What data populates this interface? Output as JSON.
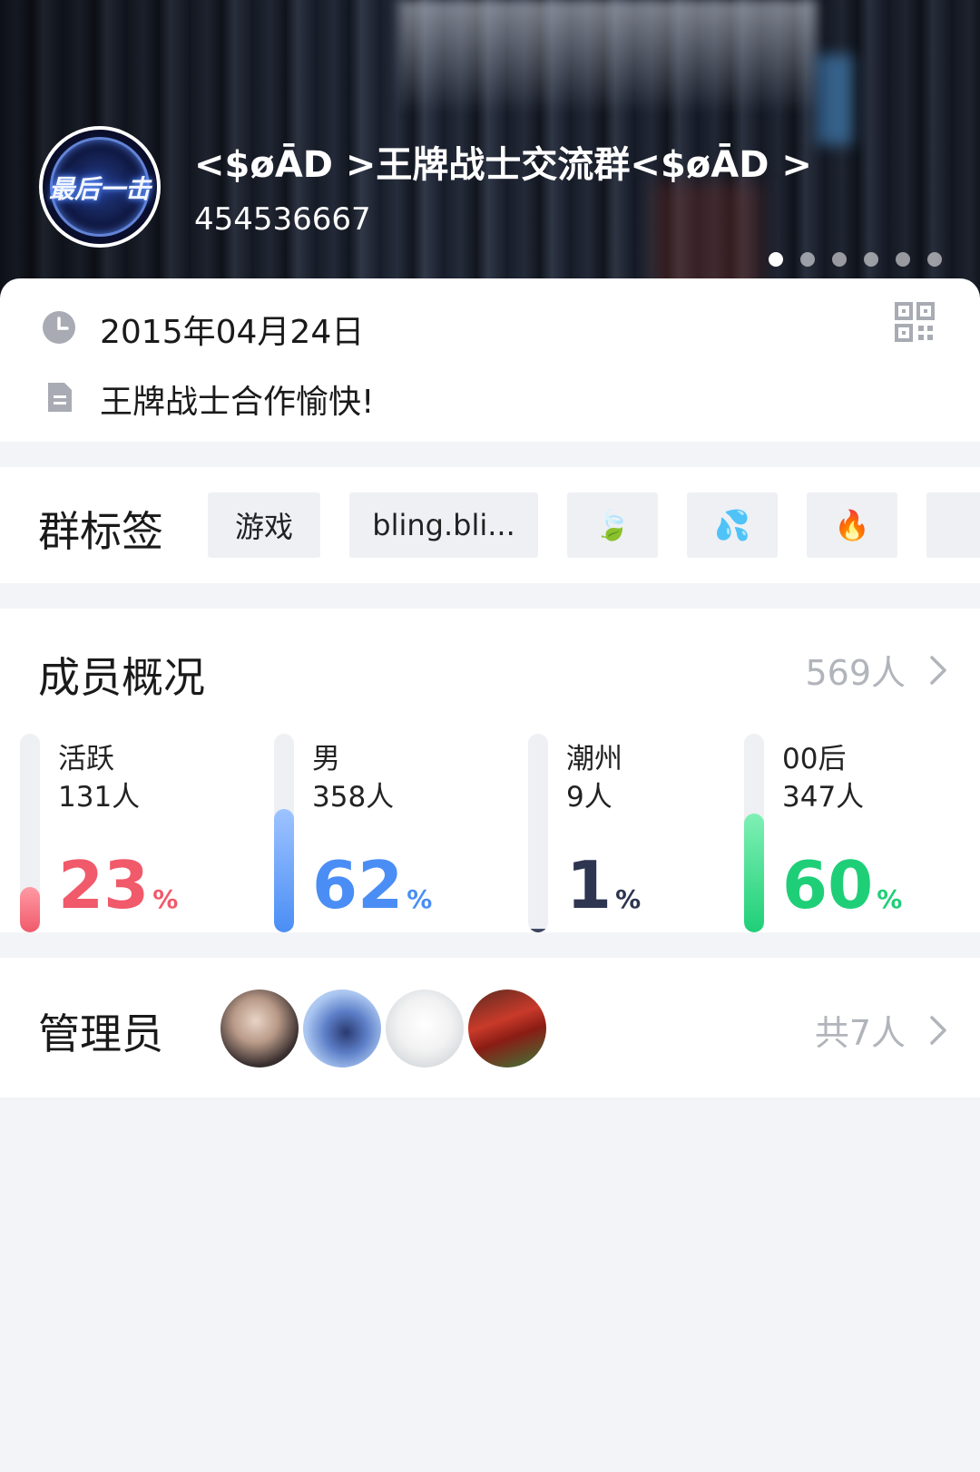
{
  "header": {
    "group_name": "<$øĀD >王牌战士交流群<$øĀD >",
    "group_id": "454536667",
    "avatar_logo_text": "最后一击",
    "carousel_count": 6
  },
  "info": {
    "created_date": "2015年04月24日",
    "description": "王牌战士合作愉快!"
  },
  "tags": {
    "title": "群标签",
    "items": [
      {
        "label": "游戏"
      },
      {
        "label": "bling.bli..."
      },
      {
        "label": "🍃"
      },
      {
        "label": "💦"
      },
      {
        "label": "🔥"
      }
    ]
  },
  "members": {
    "title": "成员概况",
    "total": "569人",
    "stats": [
      {
        "label": "活跃",
        "count": "131人",
        "percent": "23",
        "unit": "%",
        "fill": 0.23,
        "color": "#f05a6a",
        "color_light": "#ff9aa5"
      },
      {
        "label": "男",
        "count": "358人",
        "percent": "62",
        "unit": "%",
        "fill": 0.62,
        "color": "#4a8ef5",
        "color_light": "#9ec3ff"
      },
      {
        "label": "潮州",
        "count": "9人",
        "percent": "1",
        "unit": "%",
        "fill": 0.01,
        "color": "#2d3550",
        "color_light": "#4a5370"
      },
      {
        "label": "00后",
        "count": "347人",
        "percent": "60",
        "unit": "%",
        "fill": 0.6,
        "color": "#1fcf78",
        "color_light": "#7ff0b4"
      }
    ]
  },
  "admins": {
    "title": "管理员",
    "total": "共7人",
    "avatars": [
      "admin-avatar-1",
      "admin-avatar-2",
      "admin-avatar-3",
      "admin-avatar-4"
    ]
  }
}
